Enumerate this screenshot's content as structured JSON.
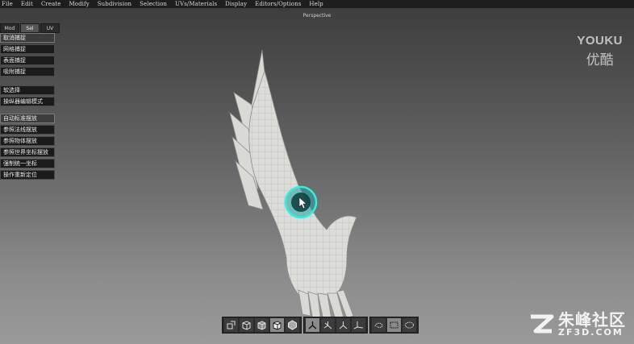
{
  "menubar": {
    "items": [
      "File",
      "Edit",
      "Create",
      "Modify",
      "Subdivision",
      "Selection",
      "UVs/Materials",
      "Display",
      "Editors/Options",
      "Help"
    ]
  },
  "viewport": {
    "title": "Perspective"
  },
  "tabs": [
    {
      "label": "Mod",
      "active": false
    },
    {
      "label": "Sel",
      "active": true
    },
    {
      "label": "UV",
      "active": false
    }
  ],
  "panel": {
    "group1": [
      "取消捕捉",
      "网格捕捉",
      "表面捕捉",
      "吸附捕捉"
    ],
    "group2": [
      "软选择",
      "操纵器编辑模式"
    ],
    "group3": [
      "自动标准摆放",
      "参照法线摆放",
      "参照物体摆放",
      "参照世界坐标摆放",
      "强制统一坐标",
      "操作重新定位"
    ]
  },
  "watermarks": {
    "youku_en": "YOUKU",
    "youku_cn": "优酷",
    "zf3d_cn": "朱峰社区",
    "zf3d_en": "ZF3D.COM"
  },
  "toolbar": {
    "group1_icons": [
      "scale-tool-icon",
      "box-wire-icon",
      "box-half-icon",
      "box-solid-icon",
      "hexagon-icon"
    ],
    "group2_icons": [
      "axes-front-icon",
      "axes-side-icon",
      "axes-top-icon",
      "axes-persp-icon"
    ],
    "group3_icons": [
      "lasso-select-icon",
      "rect-select-icon",
      "paint-select-icon"
    ],
    "active": [
      "box-solid-icon",
      "axes-front-icon",
      "rect-select-icon"
    ]
  },
  "colors": {
    "menubar_bg": "#1e1e1e",
    "model": "#dcdcd8",
    "cursor_ring": "#2fe0d6"
  }
}
